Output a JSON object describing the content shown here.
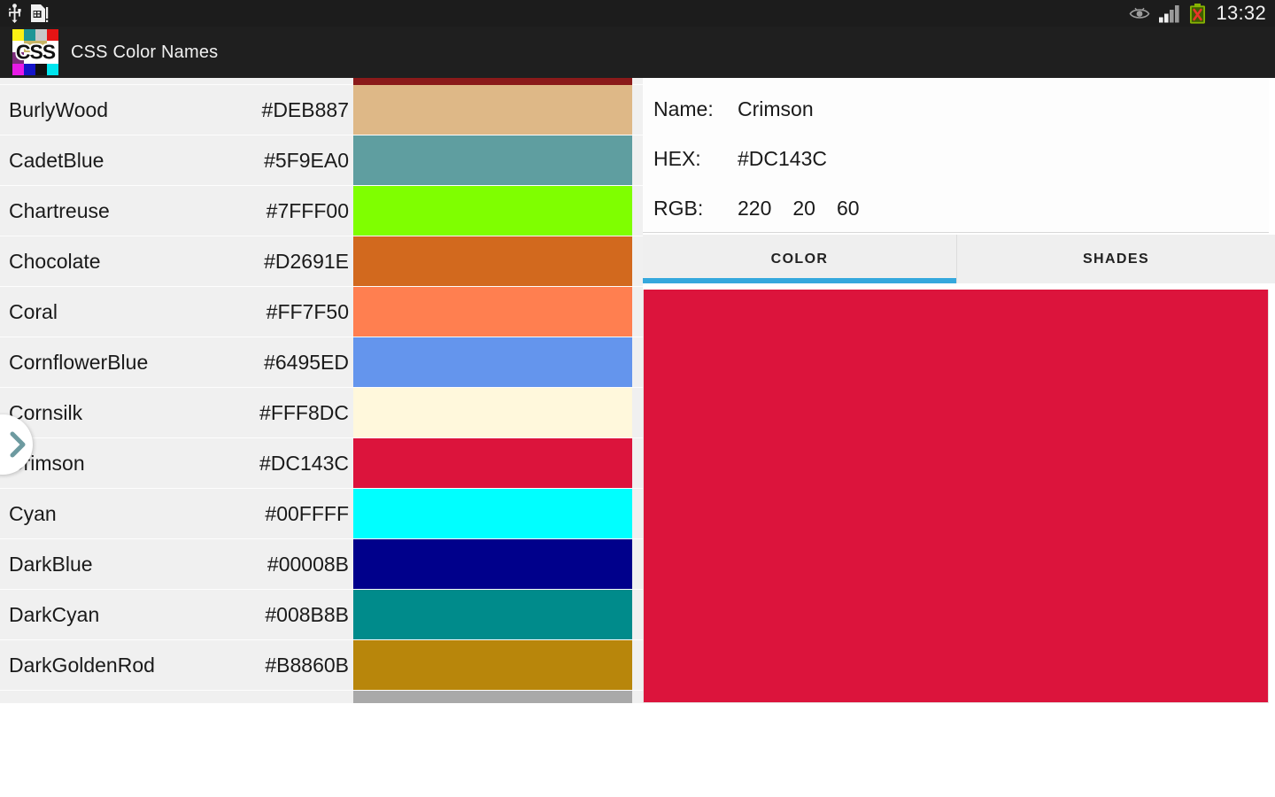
{
  "statusbar": {
    "time": "13:32",
    "icons": [
      "usb-icon",
      "sim-card-icon",
      "eye-icon",
      "signal-bars-icon",
      "battery-x-icon"
    ]
  },
  "actionbar": {
    "app_title": "CSS Color Names",
    "logo_text": "CSS",
    "logo_cells": [
      "#00E5EE",
      "#111111",
      "#1414C8",
      "#E61AE6",
      "#FFFFFF",
      "#FFFFFF",
      "#FFFFFF",
      "#7A2B7A",
      "#FFFFFF",
      "#C8B464",
      "#C8B464",
      "#FFFFFF",
      "#E61414",
      "#C8C8C8",
      "#1E9696",
      "#FAF014"
    ]
  },
  "list": {
    "partial_top": {
      "name": "",
      "hex": "",
      "swatch": "#8B1A1A"
    },
    "rows": [
      {
        "name": "BurlyWood",
        "hex": "#DEB887",
        "swatch": "#DEB887"
      },
      {
        "name": "CadetBlue",
        "hex": "#5F9EA0",
        "swatch": "#5F9EA0"
      },
      {
        "name": "Chartreuse",
        "hex": "#7FFF00",
        "swatch": "#7FFF00"
      },
      {
        "name": "Chocolate",
        "hex": "#D2691E",
        "swatch": "#D2691E"
      },
      {
        "name": "Coral",
        "hex": "#FF7F50",
        "swatch": "#FF7F50"
      },
      {
        "name": "CornflowerBlue",
        "hex": "#6495ED",
        "swatch": "#6495ED"
      },
      {
        "name": "Cornsilk",
        "hex": "#FFF8DC",
        "swatch": "#FFF8DC"
      },
      {
        "name": "Crimson",
        "hex": "#DC143C",
        "swatch": "#DC143C"
      },
      {
        "name": "Cyan",
        "hex": "#00FFFF",
        "swatch": "#00FFFF"
      },
      {
        "name": "DarkBlue",
        "hex": "#00008B",
        "swatch": "#00008B"
      },
      {
        "name": "DarkCyan",
        "hex": "#008B8B",
        "swatch": "#008B8B"
      },
      {
        "name": "DarkGoldenRod",
        "hex": "#B8860B",
        "swatch": "#B8860B"
      }
    ],
    "partial_bottom": {
      "name": "",
      "hex": "",
      "swatch": "#A9A9A9"
    },
    "drawer_handle_icon": "chevron-right-icon"
  },
  "detail": {
    "name_label": "Name:",
    "name_value": "Crimson",
    "hex_label": "HEX:",
    "hex_value": "#DC143C",
    "rgb_label": "RGB:",
    "rgb_r": "220",
    "rgb_g": "20",
    "rgb_b": "60",
    "tabs": [
      {
        "label": "COLOR",
        "active": true
      },
      {
        "label": "SHADES",
        "active": false
      }
    ],
    "preview_color": "#DC143C",
    "active_tab_indicator_color": "#35A8DD"
  }
}
